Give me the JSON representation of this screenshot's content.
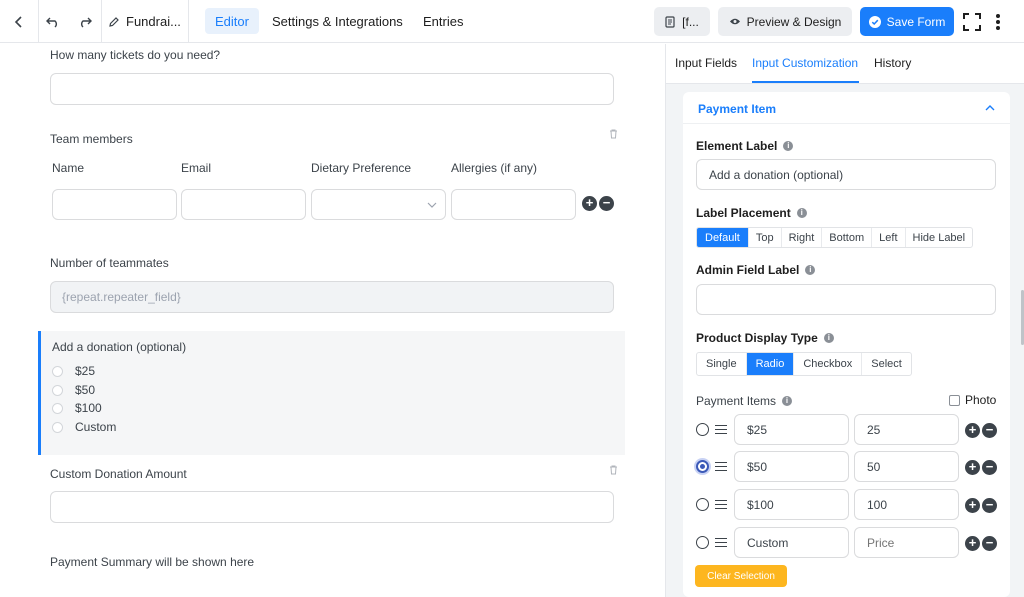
{
  "topbar": {
    "form_name": "Fundrai...",
    "tabs": [
      {
        "label": "Editor",
        "active": true
      },
      {
        "label": "Settings & Integrations",
        "active": false
      },
      {
        "label": "Entries",
        "active": false
      }
    ],
    "shortcode_label": "[f...",
    "preview_label": "Preview & Design",
    "save_label": "Save Form"
  },
  "canvas": {
    "tickets_label": "How many tickets do you need?",
    "team_label": "Team members",
    "team_columns": [
      "Name",
      "Email",
      "Dietary Preference",
      "Allergies (if any)"
    ],
    "teammates_label": "Number of teammates",
    "teammates_value": "{repeat.repeater_field}",
    "donation_label": "Add a donation (optional)",
    "donation_options": [
      "$25",
      "$50",
      "$100",
      "Custom"
    ],
    "custom_amount_label": "Custom Donation Amount",
    "summary_text": "Payment Summary will be shown here"
  },
  "panel": {
    "tabs": [
      {
        "label": "Input Fields",
        "active": false
      },
      {
        "label": "Input Customization",
        "active": true
      },
      {
        "label": "History",
        "active": false
      }
    ],
    "section_title": "Payment Item",
    "element_label": "Element Label",
    "element_label_value": "Add a donation (optional)",
    "label_placement": "Label Placement",
    "placement_options": [
      {
        "label": "Default",
        "active": true
      },
      {
        "label": "Top",
        "active": false
      },
      {
        "label": "Right",
        "active": false
      },
      {
        "label": "Bottom",
        "active": false
      },
      {
        "label": "Left",
        "active": false
      },
      {
        "label": "Hide Label",
        "active": false
      }
    ],
    "admin_label": "Admin Field Label",
    "admin_value": "",
    "display_type": "Product Display Type",
    "display_options": [
      {
        "label": "Single",
        "active": false
      },
      {
        "label": "Radio",
        "active": true
      },
      {
        "label": "Checkbox",
        "active": false
      },
      {
        "label": "Select",
        "active": false
      }
    ],
    "payment_items_label": "Payment Items",
    "photo_label": "Photo",
    "items": [
      {
        "label": "$25",
        "price": "25",
        "price_placeholder": "Price",
        "selected": false
      },
      {
        "label": "$50",
        "price": "50",
        "price_placeholder": "Price",
        "selected": true
      },
      {
        "label": "$100",
        "price": "100",
        "price_placeholder": "Price",
        "selected": false
      },
      {
        "label": "Custom",
        "price": "",
        "price_placeholder": "Price",
        "selected": false
      }
    ],
    "clear_label": "Clear Selection"
  },
  "colors": {
    "accent": "#1a7efb",
    "warning": "#fdb61f"
  }
}
